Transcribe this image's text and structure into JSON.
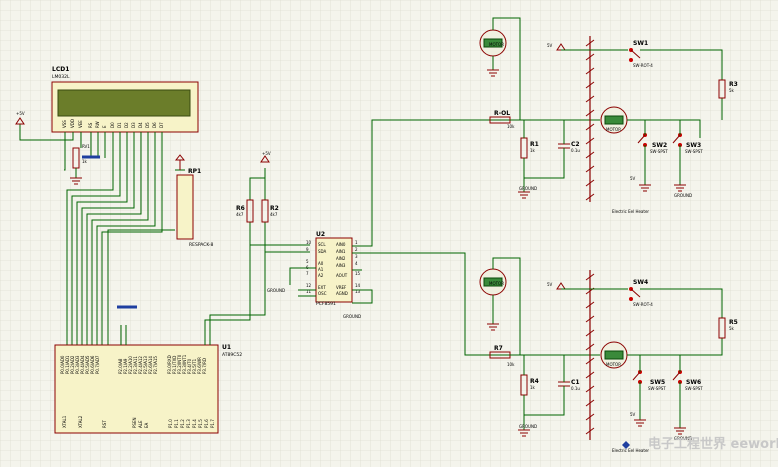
{
  "lcd": {
    "ref": "LCD1",
    "part": "LM032L",
    "pins": [
      "VSS",
      "VDD",
      "VEE",
      "RS",
      "RW",
      "E",
      "D0",
      "D1",
      "D2",
      "D3",
      "D4",
      "D5",
      "D6",
      "D7"
    ]
  },
  "u1": {
    "ref": "U1",
    "part": "AT89C52",
    "bottom_pins": [
      "XTAL1",
      "XTAL2",
      "RST",
      "PSEN",
      "ALE",
      "EA"
    ],
    "p0": [
      "P0.0/AD0",
      "P0.1/AD1",
      "P0.2/AD2",
      "P0.3/AD3",
      "P0.4/AD4",
      "P0.5/AD5",
      "P0.6/AD6",
      "P0.7/AD7"
    ],
    "p2": [
      "P2.0/A8",
      "P2.1/A9",
      "P2.2/A10",
      "P2.3/A11",
      "P2.4/A12",
      "P2.5/A13",
      "P2.6/A14",
      "P2.7/A15"
    ],
    "p3": [
      "P3.0/RXD",
      "P3.1/TXD",
      "P3.2/INT0",
      "P3.3/INT1",
      "P3.4/T0",
      "P3.5/T1",
      "P3.6/WR",
      "P3.7/RD"
    ],
    "p1": [
      "P1.0",
      "P1.1",
      "P1.2",
      "P1.3",
      "P1.4",
      "P1.5",
      "P1.6",
      "P1.7"
    ]
  },
  "u2": {
    "ref": "U2",
    "part": "PCF8591",
    "left_pins": [
      "SCL",
      "SDA",
      "A0",
      "A1",
      "A2",
      "EXT",
      "OSC"
    ],
    "right_pins": [
      "AIN0",
      "AIN1",
      "AIN2",
      "AIN3",
      "AOUT",
      "VREF",
      "AGND"
    ],
    "pin_numbers": [
      "10",
      "9",
      "5",
      "6",
      "7",
      "12",
      "11",
      "1",
      "2",
      "3",
      "4",
      "15",
      "14",
      "13"
    ]
  },
  "rp1": {
    "ref": "RP1",
    "part": "RESPACK-8"
  },
  "r6": {
    "ref": "R6",
    "value": "4k7"
  },
  "r2": {
    "ref": "R2",
    "value": "4k7"
  },
  "pot": {
    "ref": "RV1",
    "value": "1k"
  },
  "power_5v": "+5V",
  "power_5v_short": "5V",
  "ground": "GROUND",
  "text_placeholder": "<TEXT>",
  "top": {
    "motor_label": "MOTOR",
    "r_in": {
      "ref": "R-OL",
      "value": "10k"
    },
    "r1": {
      "ref": "R1",
      "value": "1k"
    },
    "c2": {
      "ref": "C2",
      "value": "0.1u"
    },
    "sw1": {
      "ref": "SW1",
      "part": "SW-ROT-4"
    },
    "sw2": {
      "ref": "SW2",
      "part": "SW-SPST"
    },
    "sw3": {
      "ref": "SW3",
      "part": "SW-SPST"
    },
    "r3": {
      "ref": "R3",
      "value": "5k"
    },
    "caption": "Electric Eel Heater"
  },
  "bottom": {
    "motor_label": "MOTOR",
    "r_in": {
      "ref": "R7",
      "value": "10k"
    },
    "r4": {
      "ref": "R4",
      "value": "1k"
    },
    "c1": {
      "ref": "C1",
      "value": "0.1u"
    },
    "sw4": {
      "ref": "SW4",
      "part": "SW-ROT-4"
    },
    "sw5": {
      "ref": "SW5",
      "part": "SW-SPST"
    },
    "sw6": {
      "ref": "SW6",
      "part": "SW-SPST"
    },
    "r5": {
      "ref": "R5",
      "value": "5k"
    },
    "caption": "Electric Eel Heater"
  },
  "watermark": "电子工程世界 eeworld.com.cn",
  "colors": {
    "wire": "#006400",
    "part": "#8b0000",
    "body": "#f7f3c8",
    "lcd": "#6b7d2a",
    "grid": "#d6d6c8",
    "bus": "#1f3fa0"
  }
}
